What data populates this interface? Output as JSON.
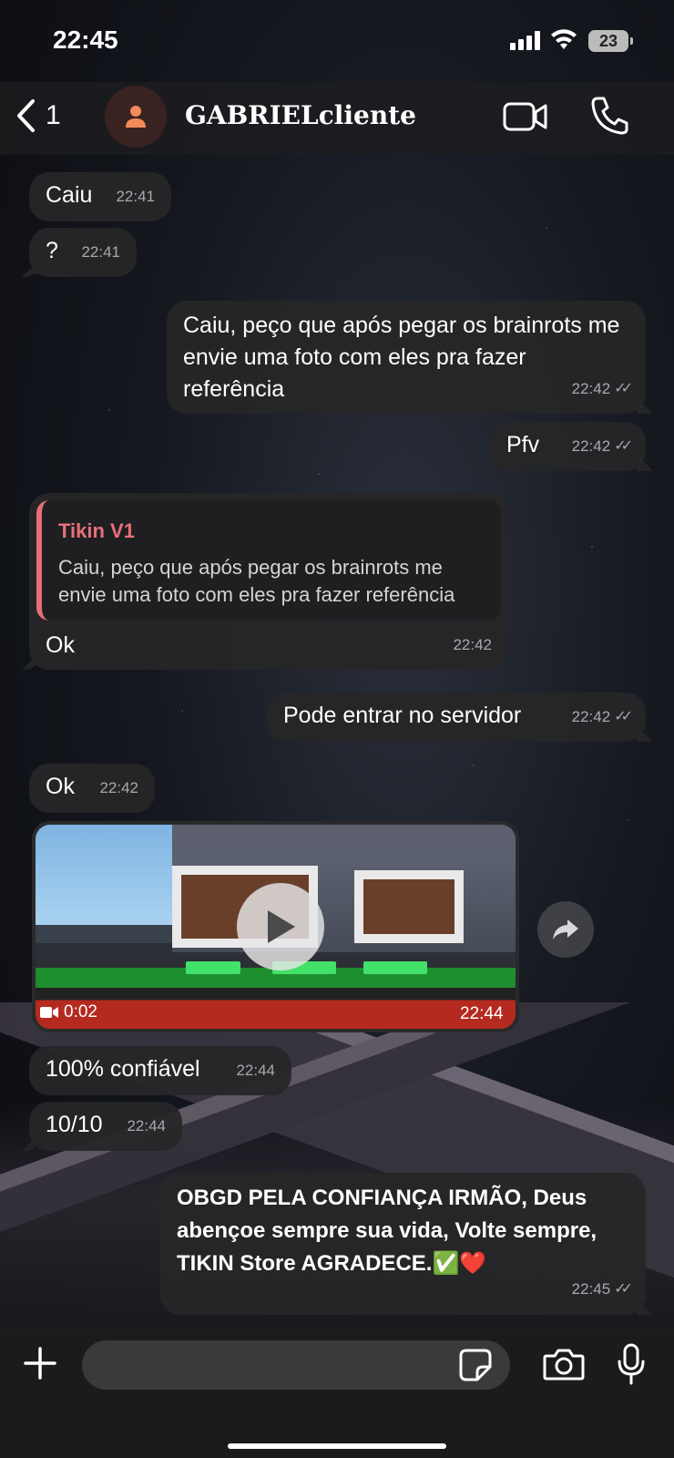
{
  "status_bar": {
    "time": "22:45",
    "battery": "23"
  },
  "header": {
    "back_count": "1",
    "contact_name": "GABRIELcliente"
  },
  "messages": [
    {
      "text": "Caiu",
      "time": "22:41"
    },
    {
      "text": "?",
      "time": "22:41"
    },
    {
      "text": "Caiu, peço que após pegar os brainrots me envie uma foto com eles pra fazer referência",
      "time": "22:42"
    },
    {
      "text": "Pfv",
      "time": "22:42"
    },
    {
      "text": "Ok",
      "time": "22:42",
      "quote_author": "Tikin V1",
      "quote_text": "Caiu, peço que após pegar os brainrots me envie uma foto com eles pra fazer referência"
    },
    {
      "text": "Pode entrar no servidor",
      "time": "22:42"
    },
    {
      "text": "Ok",
      "time": "22:42"
    },
    {
      "text": "100% confiável",
      "time": "22:44"
    },
    {
      "text": "10/10",
      "time": "22:44"
    },
    {
      "text": "OBGD PELA CONFIANÇA IRMÃO, Deus abençoe sempre sua vida, Volte sempre, TIKIN Store AGRADECE.✅❤️",
      "time": "22:45"
    }
  ],
  "video": {
    "duration": "0:02",
    "time": "22:44"
  },
  "colors": {
    "bubble": "#262628",
    "quote_accent": "#e36f78",
    "meta": "#a9a9ad"
  }
}
